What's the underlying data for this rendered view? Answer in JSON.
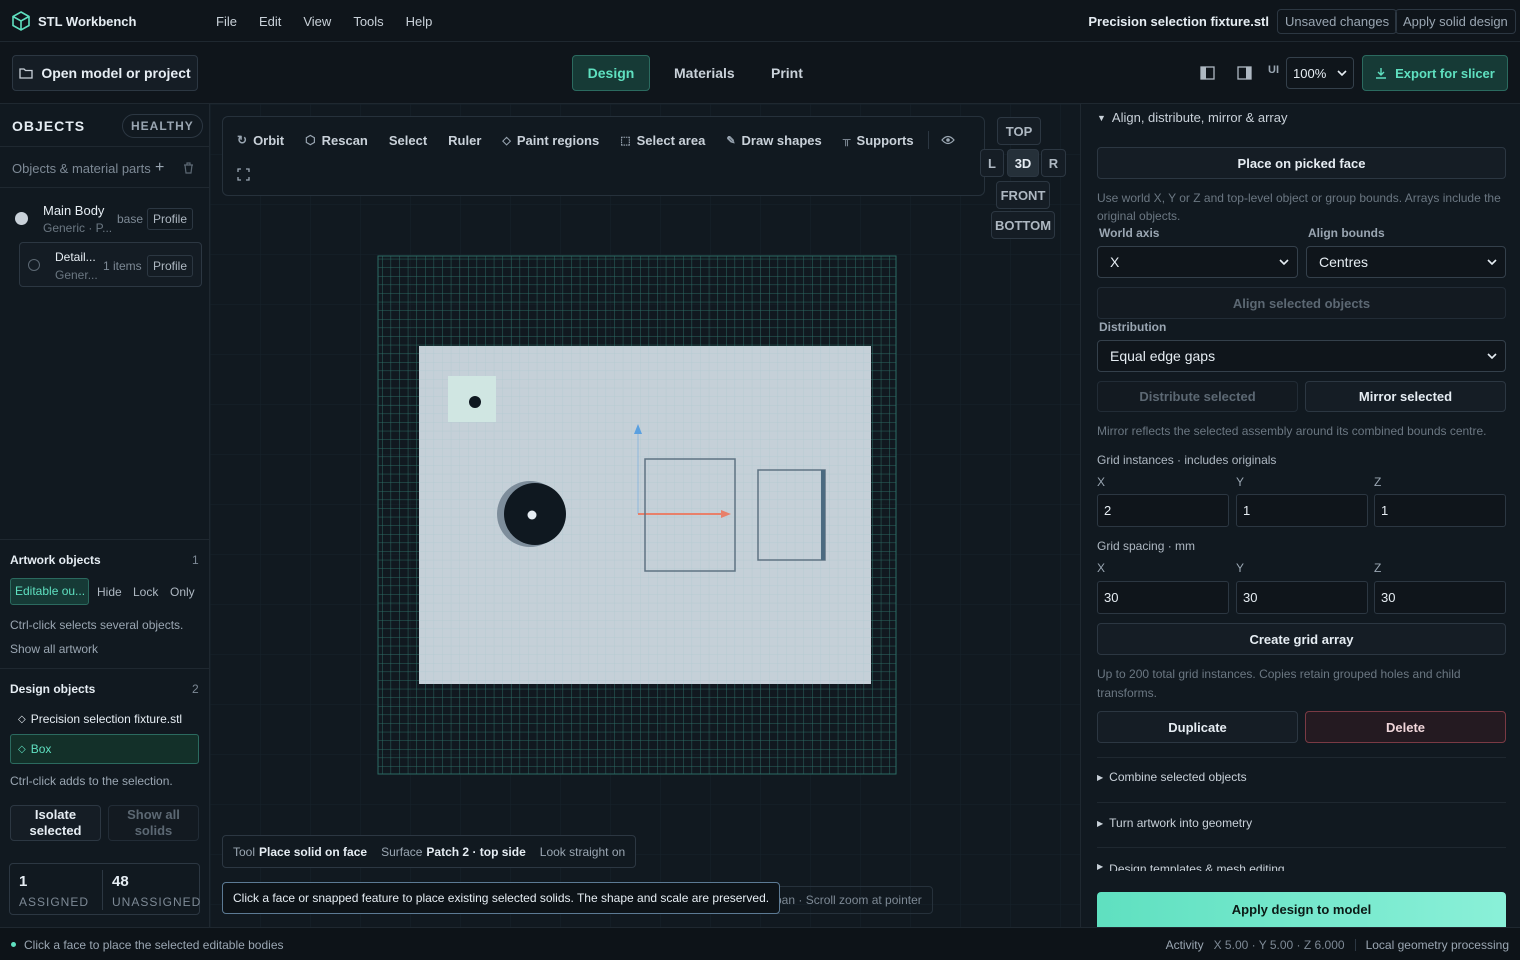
{
  "app": {
    "name": "STL Workbench"
  },
  "menu": [
    "File",
    "Edit",
    "View",
    "Tools",
    "Help"
  ],
  "header": {
    "file_name": "Precision selection fixture.stl",
    "unsaved": "Unsaved changes",
    "apply_solid": "Apply solid design"
  },
  "toolbar": {
    "open": "Open model or project",
    "tabs": [
      "Design",
      "Materials",
      "Print"
    ],
    "ui_label": "UI",
    "zoom": "100%",
    "export": "Export for slicer"
  },
  "left": {
    "objects_title": "OBJECTS",
    "health": "HEALTHY",
    "parts_label": "Objects & material parts",
    "items": [
      {
        "name": "Main Body",
        "sub": "Generic · P...",
        "tag": "base",
        "profile": "Profile"
      },
      {
        "name": "Detail...",
        "sub": "Gener...",
        "tag": "1 items",
        "profile": "Profile"
      }
    ],
    "artwork": {
      "title": "Artwork objects",
      "count": "1",
      "chips": [
        "Editable ou...",
        "Hide",
        "Lock",
        "Only"
      ],
      "hint": "Ctrl-click selects several objects.",
      "show_all": "Show all artwork"
    },
    "design": {
      "title": "Design objects",
      "count": "2",
      "items": [
        "Precision selection fixture.stl",
        "Box"
      ],
      "hint": "Ctrl-click adds to the selection."
    },
    "isolate": "Isolate selected",
    "show_solids": "Show all solids",
    "assigned": {
      "value": "1",
      "label": "ASSIGNED"
    },
    "unassigned": {
      "value": "48",
      "label": "UNASSIGNED"
    }
  },
  "viewport": {
    "tools": [
      "Orbit",
      "Rescan",
      "Select",
      "Ruler",
      "Paint regions",
      "Select area",
      "Draw shapes",
      "Supports"
    ],
    "views": {
      "top": "TOP",
      "l": "L",
      "d3": "3D",
      "r": "R",
      "front": "FRONT",
      "bottom": "BOTTOM"
    },
    "info": {
      "tool_label": "Tool",
      "tool_value": "Place solid on face",
      "surface_label": "Surface",
      "surface_value": "Patch 2 · top side",
      "look": "Look straight on"
    },
    "tip": "Click a face or snapped feature to place existing selected solids. The shape and scale are preserved.",
    "hint": "g pan · Scroll zoom at pointer"
  },
  "right": {
    "section_title": "Align, distribute, mirror & array",
    "place_face": "Place on picked face",
    "help1": "Use world X, Y or Z and top-level object or group bounds. Arrays include the original objects.",
    "world_axis_label": "World axis",
    "world_axis_value": "X",
    "align_bounds_label": "Align bounds",
    "align_bounds_value": "Centres",
    "align_selected": "Align selected objects",
    "distribution_label": "Distribution",
    "distribution_value": "Equal edge gaps",
    "distribute": "Distribute selected",
    "mirror": "Mirror selected",
    "mirror_help": "Mirror reflects the selected assembly around its combined bounds centre.",
    "grid_instances_label": "Grid instances · includes originals",
    "grid_instances": [
      {
        "axis": "X",
        "value": "2"
      },
      {
        "axis": "Y",
        "value": "1"
      },
      {
        "axis": "Z",
        "value": "1"
      }
    ],
    "grid_spacing_label": "Grid spacing · mm",
    "grid_spacing": [
      {
        "axis": "X",
        "value": "30"
      },
      {
        "axis": "Y",
        "value": "30"
      },
      {
        "axis": "Z",
        "value": "30"
      }
    ],
    "create_array": "Create grid array",
    "array_help": "Up to 200 total grid instances. Copies retain grouped holes and child transforms.",
    "duplicate": "Duplicate",
    "delete": "Delete",
    "collapsed": [
      "Combine selected objects",
      "Turn artwork into geometry",
      "Design templates & mesh editing"
    ],
    "apply_model": "Apply design to model"
  },
  "status": {
    "message": "Click a face to place the selected editable bodies",
    "activity": "Activity",
    "coords": "X 5.00 · Y 5.00 · Z 6.000",
    "processing": "Local geometry processing"
  },
  "colors": {
    "accent": "#5fe0c0",
    "bg": "#0f151b",
    "panel": "#111920",
    "delete_border": "#7a3a44"
  }
}
